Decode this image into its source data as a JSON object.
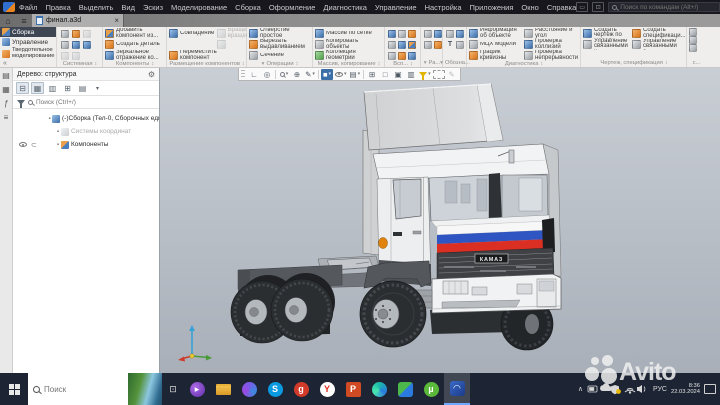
{
  "titlebar": {
    "menu": [
      "Файл",
      "Правка",
      "Выделить",
      "Вид",
      "Эскиз",
      "Моделирование",
      "Сборка",
      "Оформление",
      "Диагностика",
      "Управление",
      "Настройка",
      "Приложения",
      "Окно",
      "Справка"
    ],
    "search_placeholder": "Поиск по командам (Alt+/)",
    "window": {
      "min": "–",
      "max": "□",
      "close": "×"
    }
  },
  "tabstrip": {
    "doc_tab": "финал.a3d",
    "close": "×"
  },
  "ribbon": {
    "tabs": {
      "assembly": "Сборка",
      "management": "Управление",
      "solid": "Твердотельное моделирование",
      "collapse": "«"
    },
    "groups": {
      "system": {
        "label": "Системная"
      },
      "components": {
        "label": "Компоненты",
        "b1": "Добавить компонент из...",
        "b2": "Создать деталь",
        "b3": "Зеркальное отражение ко..."
      },
      "placement": {
        "label": "Размещение компонентов",
        "b1": "Совпадение",
        "b2": "Вращение-вращение",
        "b3": "Переместить компонент"
      },
      "operations": {
        "label": "Операции",
        "b1": "Отверстие простое",
        "b2": "Вырезать выдавливанием",
        "b3": "Сечение"
      },
      "array": {
        "label": "Массив, копирование",
        "b1": "Массив по сетке",
        "b2": "Копировать объекты",
        "b3": "Коллекция геометрии"
      },
      "aux": {
        "label": "Всп..."
      },
      "dims": {
        "label": "Ра..."
      },
      "symbols": {
        "label": "Обозна...",
        "t": "T"
      },
      "diagnostics": {
        "label": "Диагностика",
        "b1": "Информация об объекте",
        "b2": "МЦХ модели",
        "b3": "График кривизны",
        "b4": "Расстояние и угол",
        "b5": "Проверка коллизий",
        "b6": "Проверка непрерывности"
      },
      "drawing": {
        "label": "Чертеж, спецификация",
        "b1": "Создать чертеж по модели",
        "b2": "Управление связанными ч...",
        "b3": "Создать спецификаци...",
        "b4": "Управление связанными с..."
      },
      "last": {
        "label": "с..."
      }
    }
  },
  "tree": {
    "title": "Дерево: структура",
    "search_placeholder": "Поиск (Ctrl+/)",
    "root": "(-)Сборка (Тел-0, Сборочных единиц...",
    "item_cs": "Системы координат",
    "item_comp": "Компоненты"
  },
  "viewport": {
    "badge": "КАМАЗ"
  },
  "watermark": {
    "text": "Avito"
  },
  "taskbar": {
    "search_placeholder": "Поиск",
    "lang": "РУС",
    "time": "8:36",
    "date": "22.03.2024",
    "icons": {
      "skype": "S",
      "g": "g",
      "yandex": "Y",
      "powerpoint": "P"
    }
  }
}
